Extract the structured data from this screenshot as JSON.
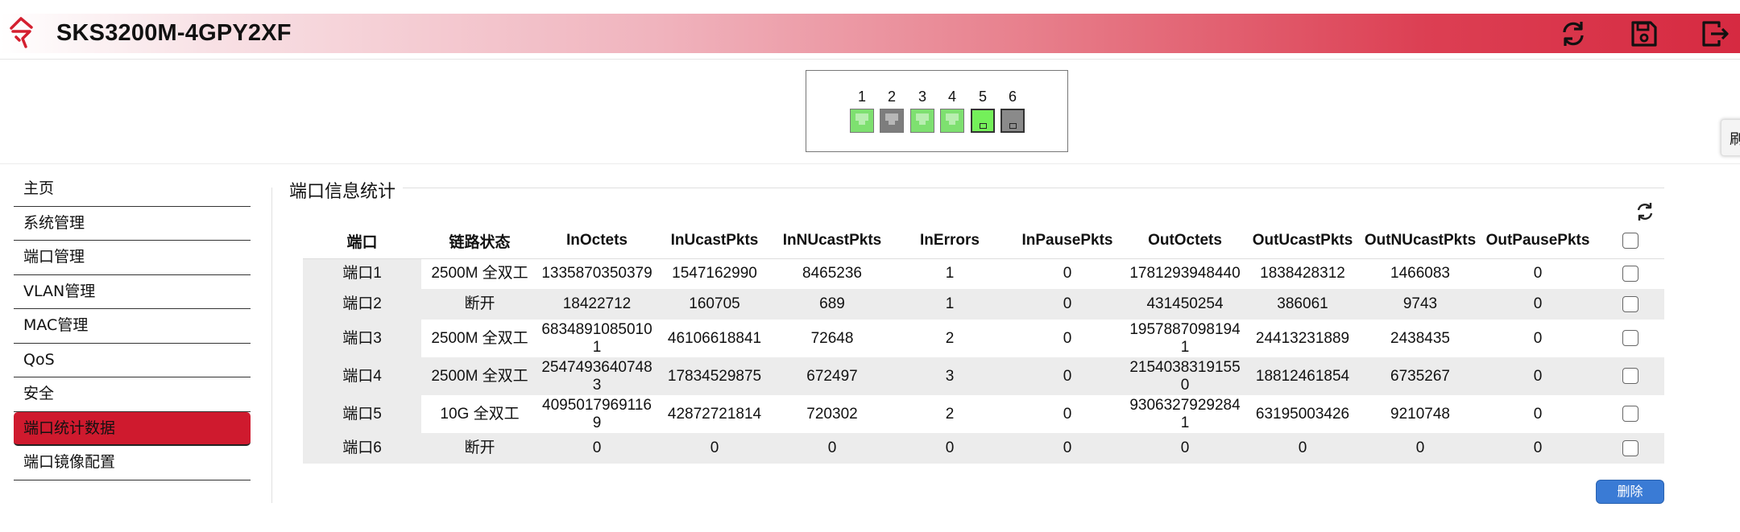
{
  "header": {
    "title": "SKS3200M-4GPY2XF",
    "brand_color": "#d62a41",
    "icons": [
      "logo-icon",
      "refresh-icon",
      "save-icon",
      "logout-icon"
    ]
  },
  "ports": [
    {
      "num": "1",
      "type": "copper",
      "status": "up"
    },
    {
      "num": "2",
      "type": "copper",
      "status": "down"
    },
    {
      "num": "3",
      "type": "copper",
      "status": "up"
    },
    {
      "num": "4",
      "type": "copper",
      "status": "up"
    },
    {
      "num": "5",
      "type": "fiber",
      "status": "up"
    },
    {
      "num": "6",
      "type": "fiber",
      "status": "down"
    }
  ],
  "side_tab": "刷",
  "sidebar": {
    "items": [
      {
        "label": "主页"
      },
      {
        "label": "系统管理"
      },
      {
        "label": "端口管理"
      },
      {
        "label": "VLAN管理"
      },
      {
        "label": "MAC管理"
      },
      {
        "label": "QoS"
      },
      {
        "label": "安全"
      },
      {
        "label": "端口统计数据",
        "active": true
      },
      {
        "label": "端口镜像配置"
      }
    ]
  },
  "main": {
    "section_title": "端口信息统计",
    "columns": [
      "端口",
      "链路状态",
      "InOctets",
      "InUcastPkts",
      "InNUcastPkts",
      "InErrors",
      "InPausePkts",
      "OutOctets",
      "OutUcastPkts",
      "OutNUcastPkts",
      "OutPausePkts"
    ],
    "rows": [
      [
        "端口1",
        "2500M 全双工",
        "1335870350379",
        "1547162990",
        "8465236",
        "1",
        "0",
        "1781293948440",
        "1838428312",
        "1466083",
        "0"
      ],
      [
        "端口2",
        "断开",
        "18422712",
        "160705",
        "689",
        "1",
        "0",
        "431450254",
        "386061",
        "9743",
        "0"
      ],
      [
        "端口3",
        "2500M 全双工",
        "68348910850101",
        "46106618841",
        "72648",
        "2",
        "0",
        "19578870981941",
        "24413231889",
        "2438435",
        "0"
      ],
      [
        "端口4",
        "2500M 全双工",
        "25474936407483",
        "17834529875",
        "672497",
        "3",
        "0",
        "21540383191550",
        "18812461854",
        "6735267",
        "0"
      ],
      [
        "端口5",
        "10G 全双工",
        "40950179691169",
        "42872721814",
        "720302",
        "2",
        "0",
        "93063279292841",
        "63195003426",
        "9210748",
        "0"
      ],
      [
        "端口6",
        "断开",
        "0",
        "0",
        "0",
        "0",
        "0",
        "0",
        "0",
        "0",
        "0"
      ]
    ],
    "delete_label": "删除"
  }
}
